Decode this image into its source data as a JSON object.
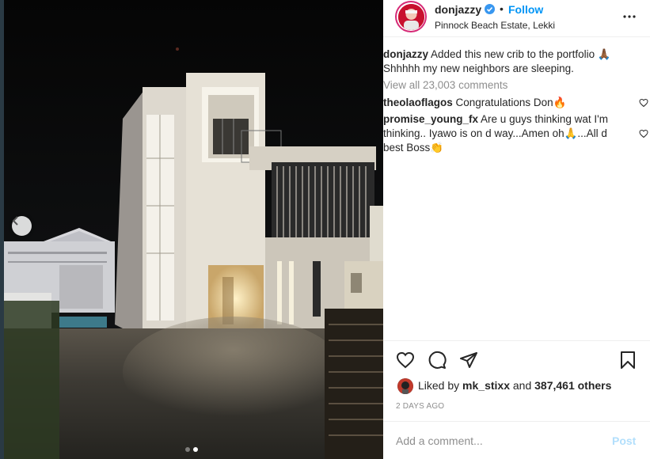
{
  "post": {
    "username": "donjazzy",
    "follow_label": "Follow",
    "separator": "•",
    "location": "Pinnock Beach Estate, Lekki",
    "caption_line1": "Added this new crib to the portfolio 🙏🏾",
    "caption_line2": "Shhhhh my new neighbors are sleeping.",
    "view_all_comments": "View all 23,003 comments",
    "comments": [
      {
        "user": "theolaoflagos",
        "text_line1": "Congratulations Don🔥"
      },
      {
        "user": "promise_young_fx",
        "text_line1": "Are u guys thinking wat I'm",
        "text_line2": "thinking.. Iyawo is on d way...Amen oh🙏...All d",
        "text_line3": "best Boss👏"
      }
    ],
    "liked_prefix": "Liked by",
    "liked_by_user": "mk_stixx",
    "liked_and": "and",
    "liked_others": "387,461 others",
    "timestamp": "2 DAYS AGO",
    "add_comment_placeholder": "Add a comment...",
    "post_button": "Post"
  },
  "carousel": {
    "slide_count": 2,
    "active_slide": 2
  },
  "colors": {
    "link_blue": "#0095f6",
    "post_button_disabled": "#b2dffc",
    "muted_text": "#8e8e8e",
    "verified_badge": "#3897f0",
    "story_ring": "#d62976"
  },
  "icons": [
    "chevron-left-icon",
    "verified-badge-icon",
    "more-options-icon",
    "heart-icon",
    "comment-icon",
    "share-icon",
    "bookmark-icon"
  ]
}
